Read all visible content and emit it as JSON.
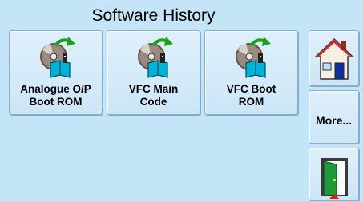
{
  "header": {
    "title": "Software History"
  },
  "tiles": [
    {
      "line1": "Analogue O/P",
      "line2": "Boot ROM",
      "icon": "software-cd-book-icon"
    },
    {
      "line1": "VFC Main",
      "line2": "Code",
      "icon": "software-cd-book-icon"
    },
    {
      "line1": "VFC Boot",
      "line2": "ROM",
      "icon": "software-cd-book-icon"
    }
  ],
  "side_buttons": {
    "home_icon": "home-icon",
    "more_label": "More...",
    "exit_icon": "exit-door-icon"
  },
  "colors": {
    "background": "#c4e4f7",
    "button_face": "#d4eaf8",
    "book": "#00b4d8",
    "arrow": "#1ea01e"
  }
}
